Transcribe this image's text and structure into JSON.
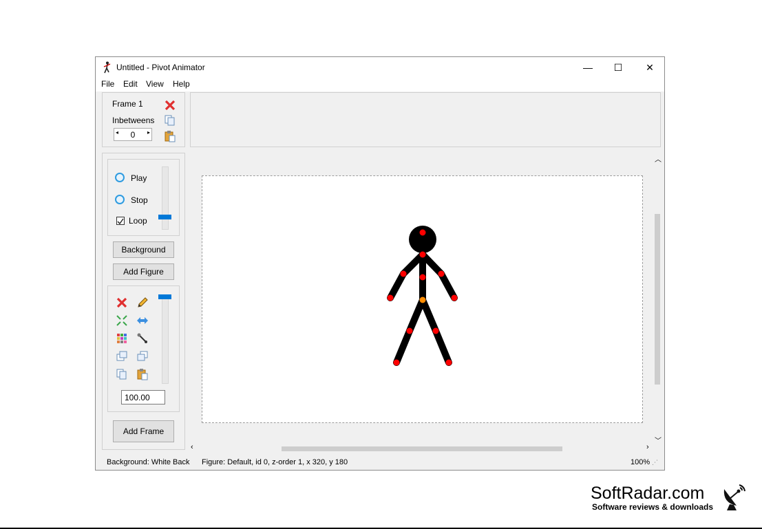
{
  "window": {
    "title": "Untitled - Pivot Animator",
    "controls": {
      "minimize": "—",
      "maximize": "☐",
      "close": "✕"
    }
  },
  "menu": [
    "File",
    "Edit",
    "View",
    "Help"
  ],
  "frame_panel": {
    "frame_label": "Frame 1",
    "inbetweens_label": "Inbetweens",
    "inbetweens_value": "0"
  },
  "playback": {
    "play_label": "Play",
    "stop_label": "Stop",
    "loop_label": "Loop",
    "loop_checked": true,
    "speed_level": 0.18
  },
  "buttons": {
    "background": "Background",
    "add_figure": "Add Figure",
    "add_frame": "Add Frame"
  },
  "figure_tools": {
    "scale_value": "100.00",
    "transparency_level": 0.0,
    "icons": [
      "delete-icon",
      "edit-icon",
      "center-icon",
      "flip-icon",
      "color-icon",
      "joint-icon",
      "move-up-icon",
      "move-down-icon",
      "copy-icon",
      "paste-icon"
    ]
  },
  "status": {
    "background": "Background: White Back",
    "figure": "Figure: Default,  id 0,  z-order 1,  x 320, y 180",
    "zoom": "100%"
  },
  "watermark": {
    "brand": "SoftRadar.com",
    "tagline": "Software reviews & downloads"
  },
  "colors": {
    "joint": "#ff0000",
    "origin_joint": "#ff8c00",
    "accent": "#0078d7",
    "figure": "#000000"
  }
}
